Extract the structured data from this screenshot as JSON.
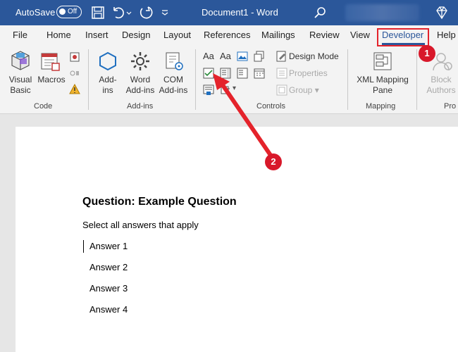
{
  "titlebar": {
    "autosave_label": "AutoSave",
    "toggle_state": "Off",
    "document_title": "Document1 - Word"
  },
  "tabs": [
    {
      "label": "File"
    },
    {
      "label": "Home"
    },
    {
      "label": "Insert"
    },
    {
      "label": "Design"
    },
    {
      "label": "Layout"
    },
    {
      "label": "References"
    },
    {
      "label": "Mailings"
    },
    {
      "label": "Review"
    },
    {
      "label": "View"
    },
    {
      "label": "Developer"
    },
    {
      "label": "Help"
    }
  ],
  "ribbon": {
    "code": {
      "group_label": "Code",
      "visual_basic": "Visual\nBasic",
      "macros": "Macros"
    },
    "addins": {
      "group_label": "Add-ins",
      "addins": "Add-\nins",
      "word_addins": "Word\nAdd-ins",
      "com_addins": "COM\nAdd-ins"
    },
    "controls": {
      "group_label": "Controls",
      "design_mode": "Design Mode",
      "properties": "Properties",
      "group": "Group"
    },
    "mapping": {
      "group_label": "Mapping",
      "xml_mapping_pane": "XML Mapping\nPane"
    },
    "protect": {
      "block_authors": "Block\nAuthors",
      "group_label_partial": "Pro"
    }
  },
  "document": {
    "question_title": "Question: Example Question",
    "instruction": "Select all answers that apply",
    "answers": [
      "Answer 1",
      "Answer 2",
      "Answer 3",
      "Answer 4"
    ]
  },
  "annotations": {
    "badge_1": "1",
    "badge_2": "2",
    "accent_color": "#d8182a"
  },
  "colors": {
    "titlebar": "#2b579a",
    "ribbon_bg": "#f3f3f3",
    "page_bg": "#ffffff"
  }
}
